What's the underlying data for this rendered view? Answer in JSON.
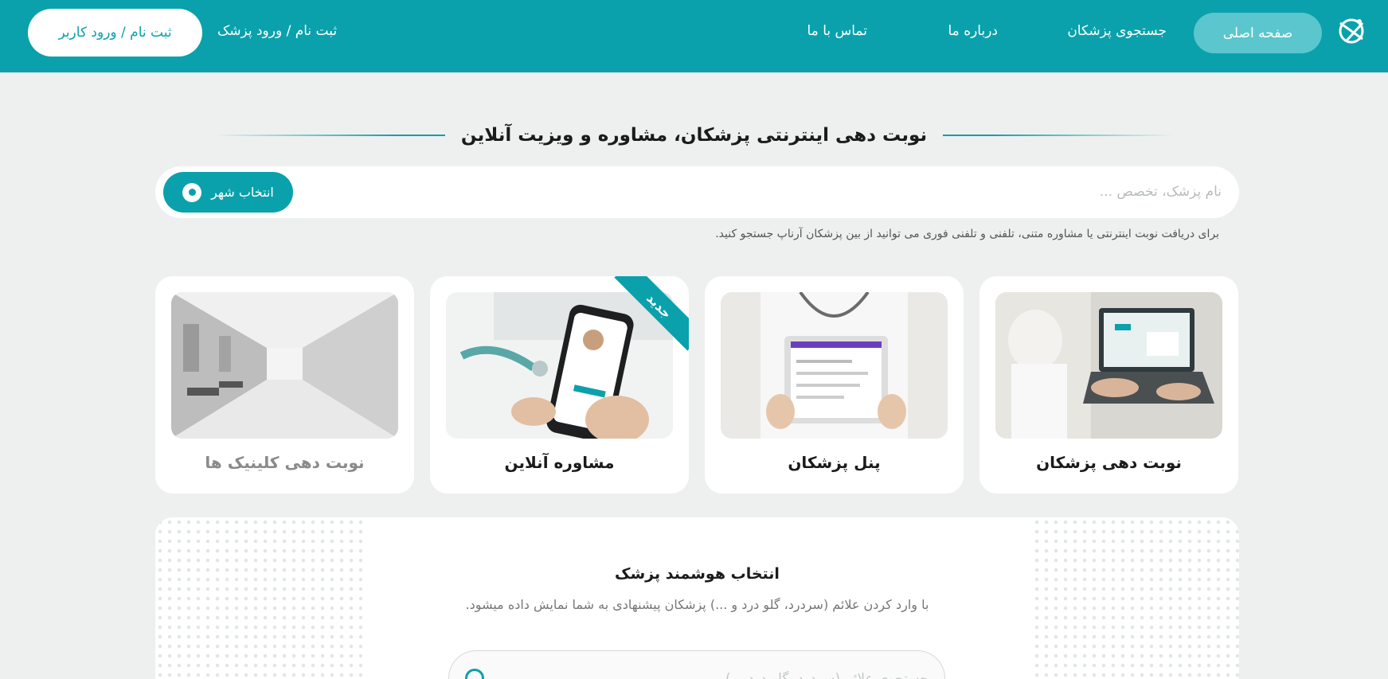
{
  "header": {
    "nav": {
      "home": "صفحه اصلی",
      "search_doctors": "جستجوی پزشکان",
      "about": "درباره ما",
      "contact": "تماس با ما"
    },
    "doctor_login": "ثبت نام / ورود پزشک",
    "user_login": "ثبت نام / ورود کاربر"
  },
  "hero": {
    "title": "نوبت دهی اینترنتی پزشکان، مشاوره و ویزیت آنلاین",
    "search_placeholder": "نام پزشک، تخصص ...",
    "city_button": "انتخاب شهر",
    "hint": "برای دریافت نوبت اینترنتی یا مشاوره متنی، تلفنی و تلفنی فوری می توانید از بین پزشکان آرناپ جستجو کنید."
  },
  "cards": [
    {
      "label": "نوبت دهی پزشکان"
    },
    {
      "label": "پنل پزشکان"
    },
    {
      "label": "مشاوره آنلاین",
      "badge": "جدید"
    },
    {
      "label": "نوبت دهی کلینیک ها"
    }
  ],
  "smart": {
    "title": "انتخاب هوشمند پزشک",
    "description": "با وارد کردن علائم (سردرد، گلو درد و ...) پزشکان پیشنهادی به شما نمایش داده میشود.",
    "placeholder": "جستجوی علائم (سردرد، گلو درد ...)"
  },
  "colors": {
    "brand": "#0aa1ac",
    "brand_light": "#5bc6cd",
    "background": "#eef0ef"
  }
}
